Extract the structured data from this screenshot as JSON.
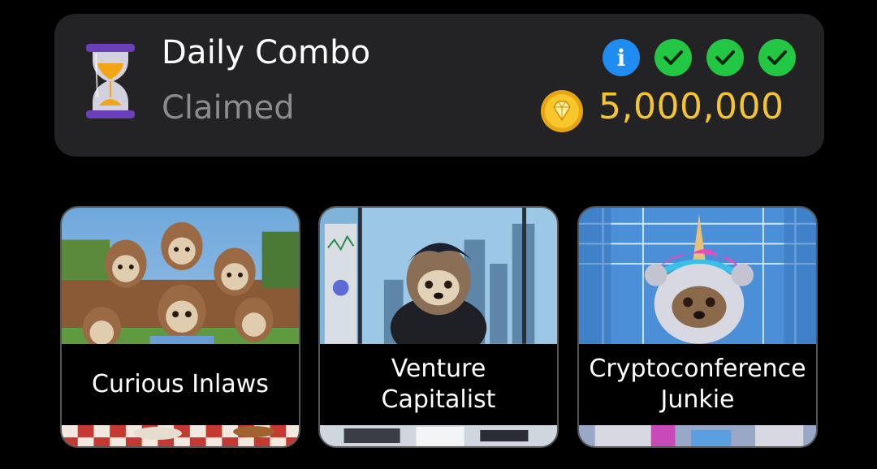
{
  "combo": {
    "title": "Daily Combo",
    "status": "Claimed",
    "reward": "5,000,000",
    "icons": {
      "hourglass": "hourglass-icon",
      "info": "info-icon",
      "check": "check-icon",
      "coin": "coin-icon"
    },
    "info_glyph": "i",
    "colors": {
      "panel": "#232325",
      "status": "#8c8c8e",
      "reward": "#f4c431",
      "info": "#1e8cf0",
      "check": "#23c744"
    }
  },
  "cards": [
    {
      "label": "Curious Inlaws",
      "art": "sloth family portrait in backyard"
    },
    {
      "label": "Venture Capitalist",
      "art": "sloth in office with city view"
    },
    {
      "label": "Cryptoconference Junkie",
      "art": "sloth with unicorn horn and rainbow mane"
    }
  ]
}
